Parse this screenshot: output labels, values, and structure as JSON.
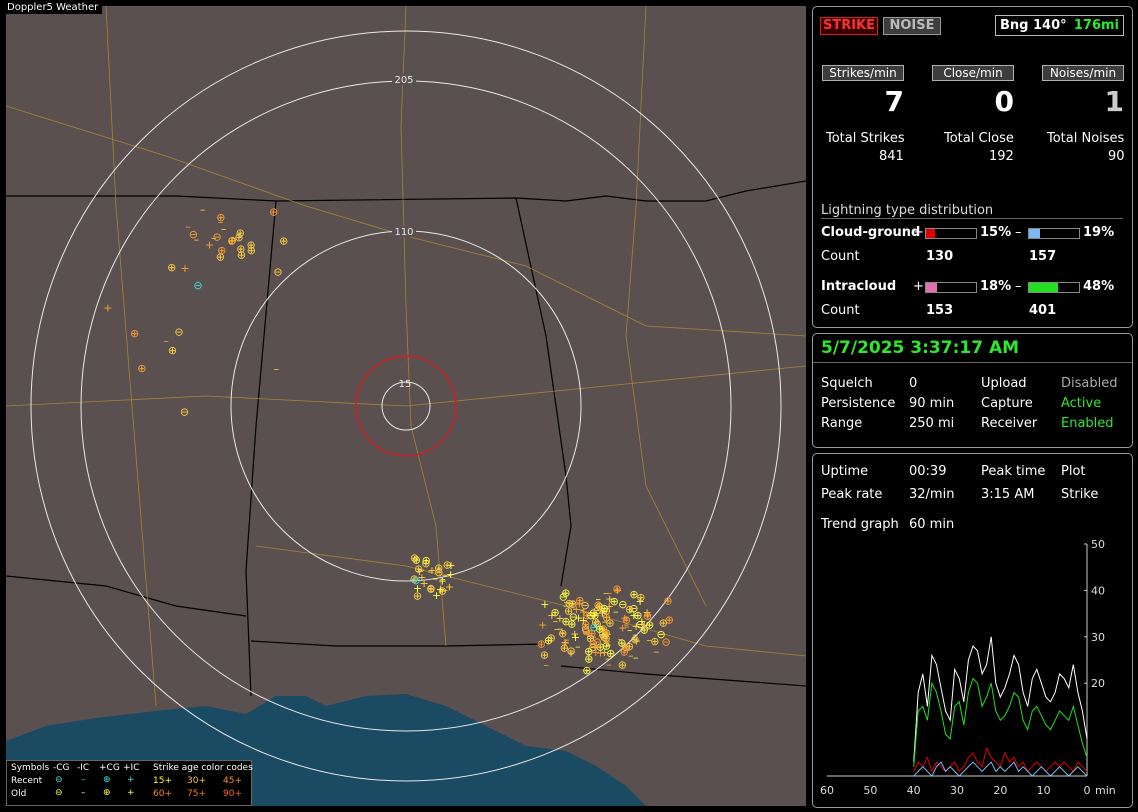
{
  "app": {
    "title": "Doppler5 Weather"
  },
  "map": {
    "ring_labels": [
      "205",
      "110",
      "15"
    ],
    "legend": {
      "header_symbols": "Symbols",
      "cols": [
        "-CG",
        "-IC",
        "+CG",
        "+IC"
      ],
      "age_header": "Strike age color codes",
      "rows": [
        {
          "label": "Recent",
          "ages": [
            "15+",
            "30+",
            "45+"
          ]
        },
        {
          "label": "Old",
          "ages": [
            "60+",
            "75+",
            "90+"
          ]
        }
      ]
    }
  },
  "status": {
    "strike_btn": "STRIKE",
    "noise_btn": "NOISE",
    "bearing_label": "Bng 140°",
    "distance": "176mi",
    "rate_labels": [
      "Strikes/min",
      "Close/min",
      "Noises/min"
    ],
    "rate_values": [
      "7",
      "0",
      "1"
    ],
    "total_labels": [
      "Total Strikes",
      "Total Close",
      "Total Noises"
    ],
    "total_values": [
      "841",
      "192",
      "90"
    ],
    "dist_title": "Lightning type distribution",
    "cg_label": "Cloud-ground",
    "ic_label": "Intracloud",
    "count_label": "Count",
    "plus": "+",
    "minus": "–",
    "cg_pos_pct": "15%",
    "cg_neg_pct": "19%",
    "cg_pos_count": "130",
    "cg_neg_count": "157",
    "ic_pos_pct": "18%",
    "ic_neg_pct": "48%",
    "ic_pos_count": "153",
    "ic_neg_count": "401",
    "bars": {
      "cg_pos": 0.15,
      "cg_neg": 0.19,
      "ic_pos": 0.18,
      "ic_neg": 0.48
    },
    "colors": {
      "cg_pos": "#e00000",
      "cg_neg": "#7ab8f0",
      "ic_pos": "#e070b0",
      "ic_neg": "#20e020"
    }
  },
  "settings": {
    "datetime": "5/7/2025 3:37:17 AM",
    "squelch_label": "Squelch",
    "squelch": "0",
    "persistence_label": "Persistence",
    "persistence": "90 min",
    "range_label": "Range",
    "range": "250 mi",
    "upload_label": "Upload",
    "upload": "Disabled",
    "capture_label": "Capture",
    "capture": "Active",
    "receiver_label": "Receiver",
    "receiver": "Enabled"
  },
  "stats": {
    "uptime_label": "Uptime",
    "uptime": "00:39",
    "peak_time_label": "Peak time",
    "peak_time": "3:15 AM",
    "plot_label": "Plot",
    "plot": "Strike",
    "peak_rate_label": "Peak rate",
    "peak_rate": "32/min",
    "trend_label": "Trend graph",
    "trend": "60 min"
  },
  "chart_data": {
    "type": "line",
    "x_ticks": [
      "60",
      "50",
      "40",
      "30",
      "20",
      "10",
      "0"
    ],
    "x_unit": "min",
    "y_ticks": [
      "50",
      "40",
      "30",
      "20"
    ],
    "ylim": [
      0,
      50
    ],
    "xlim": [
      60,
      0
    ],
    "series": [
      {
        "color": "#ffffff",
        "values": [
          3,
          18,
          22,
          15,
          26,
          24,
          19,
          14,
          12,
          23,
          21,
          16,
          25,
          28,
          27,
          22,
          24,
          30,
          20,
          17,
          19,
          22,
          26,
          24,
          18,
          15,
          21,
          23,
          20,
          17,
          16,
          18,
          22,
          21,
          19,
          24,
          18,
          14,
          8
        ]
      },
      {
        "color": "#20e020",
        "values": [
          2,
          14,
          15,
          12,
          20,
          18,
          14,
          9,
          8,
          15,
          16,
          11,
          18,
          21,
          20,
          15,
          17,
          20,
          14,
          12,
          13,
          15,
          18,
          17,
          12,
          10,
          14,
          15,
          13,
          11,
          10,
          12,
          14,
          13,
          12,
          15,
          11,
          7,
          4
        ]
      },
      {
        "color": "#e00000",
        "values": [
          1,
          3,
          2,
          4,
          1,
          3,
          2,
          1,
          2,
          3,
          1,
          2,
          4,
          5,
          3,
          2,
          6,
          4,
          3,
          2,
          5,
          3,
          4,
          2,
          3,
          1,
          2,
          3,
          2,
          1,
          2,
          3,
          2,
          3,
          2,
          1,
          3,
          2,
          1
        ]
      },
      {
        "color": "#7ab8f0",
        "values": [
          0,
          1,
          2,
          1,
          0,
          2,
          3,
          1,
          2,
          1,
          0,
          1,
          2,
          3,
          2,
          1,
          2,
          3,
          1,
          2,
          1,
          2,
          3,
          1,
          2,
          1,
          0,
          1,
          2,
          1,
          0,
          1,
          2,
          1,
          0,
          1,
          2,
          1,
          0
        ]
      }
    ]
  }
}
